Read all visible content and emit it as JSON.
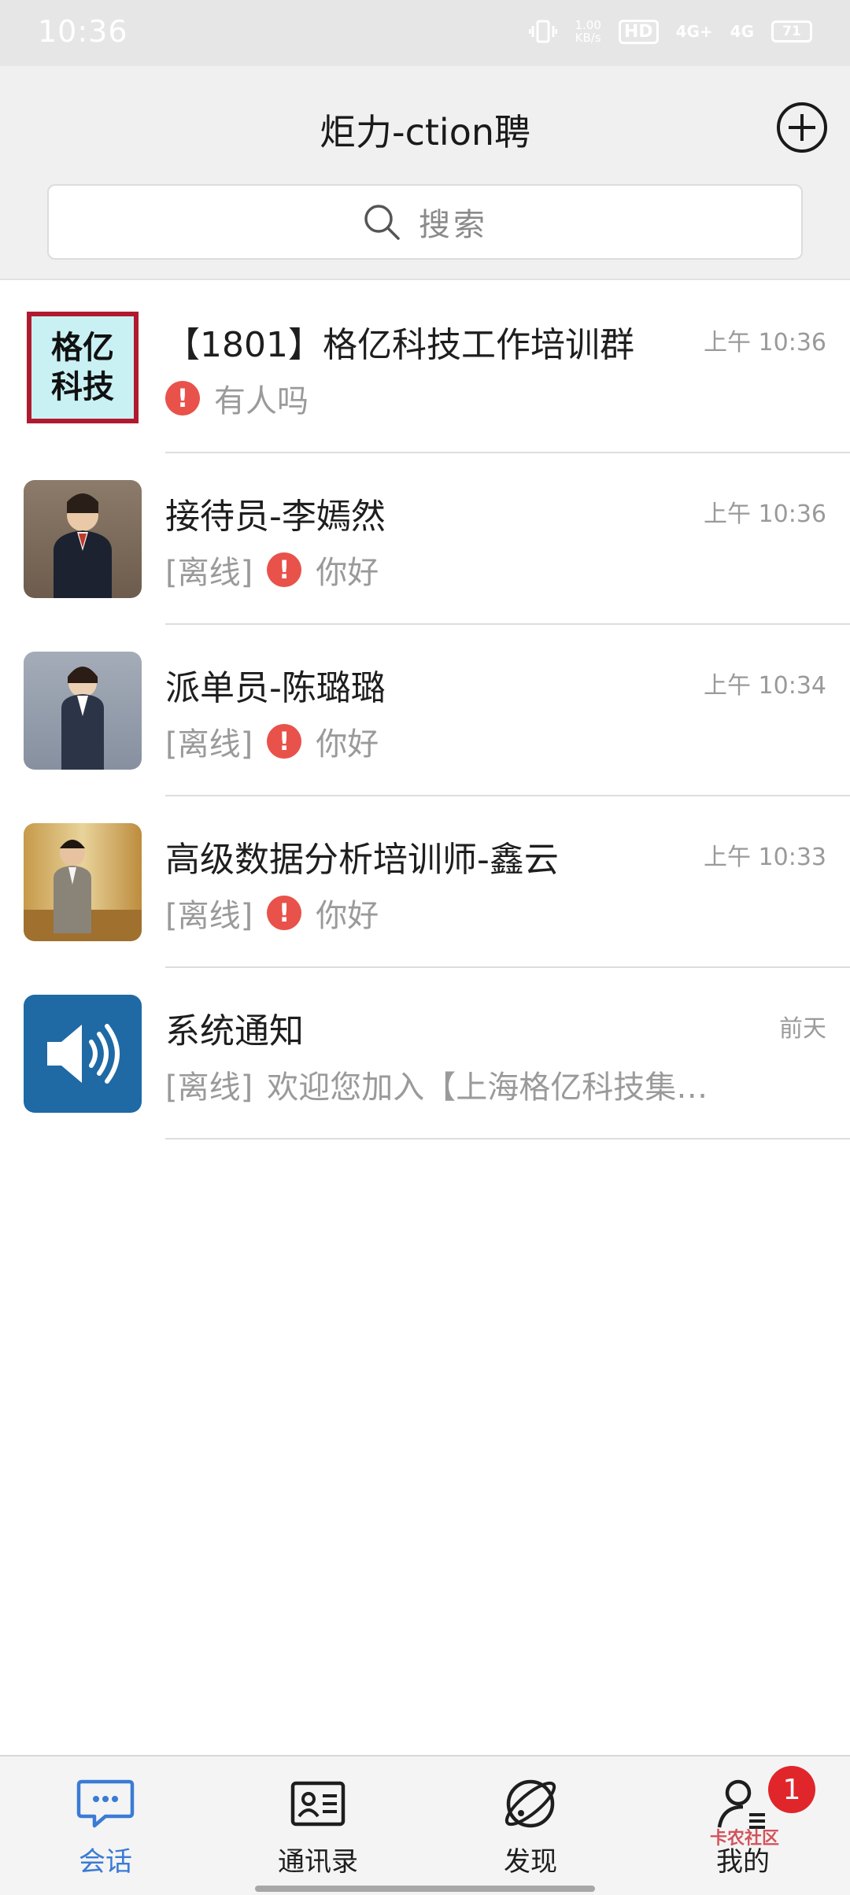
{
  "status_bar": {
    "time": "10:36",
    "speed_top": "1.00",
    "speed_unit": "KB/s",
    "hd": "HD",
    "signal1": "4G+",
    "signal2": "4G",
    "battery": "71"
  },
  "header": {
    "title": "炬力-ction聘",
    "add_icon": "plus-circle-icon"
  },
  "search": {
    "placeholder": "搜索",
    "icon": "search-icon"
  },
  "conversations": [
    {
      "name": "【1801】格亿科技工作培训群",
      "time": "上午 10:36",
      "status": "",
      "alert": true,
      "preview": "有人吗",
      "avatar_text": [
        "格亿",
        "科技"
      ]
    },
    {
      "name": "接待员-李嫣然",
      "time": "上午 10:36",
      "status": "[离线]",
      "alert": true,
      "preview": "你好"
    },
    {
      "name": "派单员-陈璐璐",
      "time": "上午 10:34",
      "status": "[离线]",
      "alert": true,
      "preview": "你好"
    },
    {
      "name": "高级数据分析培训师-鑫云",
      "time": "上午 10:33",
      "status": "[离线]",
      "alert": true,
      "preview": "你好"
    },
    {
      "name": "系统通知",
      "time": "前天",
      "status": "[离线]",
      "alert": false,
      "preview": "欢迎您加入【上海格亿科技集…"
    }
  ],
  "bottom_nav": {
    "items": [
      {
        "label": "会话",
        "icon": "chat-bubble-icon",
        "active": true
      },
      {
        "label": "通讯录",
        "icon": "contact-card-icon",
        "active": false
      },
      {
        "label": "发现",
        "icon": "planet-icon",
        "active": false
      },
      {
        "label": "我的",
        "icon": "profile-icon",
        "active": false
      }
    ],
    "badge": "1",
    "watermark": "卡农社区"
  },
  "colors": {
    "accent": "#3a7bd5",
    "alert": "#e8524a",
    "badge": "#e0262b",
    "system_avatar": "#1f6aa5"
  }
}
